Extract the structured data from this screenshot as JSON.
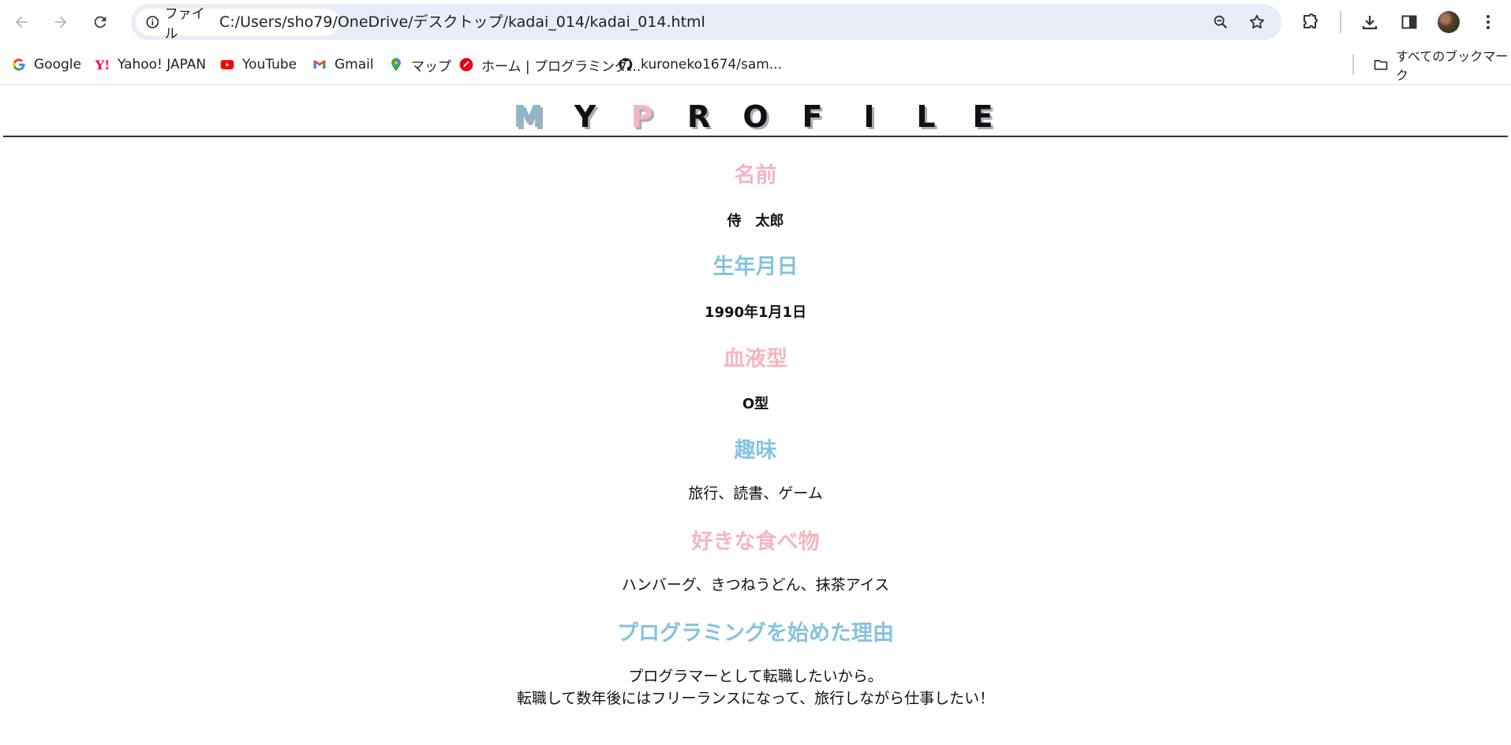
{
  "browser": {
    "chip_label": "ファイル",
    "url": "C:/Users/sho79/OneDrive/デスクトップ/kadai_014/kadai_014.html",
    "icons": [
      "back-icon",
      "forward-icon",
      "reload-icon",
      "info-icon",
      "zoom-icon",
      "star-icon",
      "extensions-icon",
      "download-icon",
      "sidepanel-icon",
      "profile-avatar",
      "menu-icon"
    ]
  },
  "bookmarks": {
    "items": [
      {
        "label": "Google",
        "icon": "google-icon"
      },
      {
        "label": "Yahoo! JAPAN",
        "icon": "yahoo-icon"
      },
      {
        "label": "YouTube",
        "icon": "youtube-icon"
      },
      {
        "label": "Gmail",
        "icon": "gmail-icon"
      },
      {
        "label": "マップ",
        "icon": "maps-icon"
      },
      {
        "label": "ホーム | プログラミング...",
        "icon": "samurai-icon"
      },
      {
        "label": "kuroneko1674/sam...",
        "icon": "github-icon"
      }
    ],
    "all_bookmarks": "すべてのブックマーク"
  },
  "page": {
    "logo_letters": [
      "M",
      "Y",
      "P",
      "R",
      "O",
      "F",
      "I",
      "L",
      "E"
    ],
    "sections": [
      {
        "heading": "名前",
        "value": "侍　太郎"
      },
      {
        "heading": "生年月日",
        "value": "1990年1月1日"
      },
      {
        "heading": "血液型",
        "value": "O型"
      },
      {
        "heading": "趣味",
        "value": "旅行、読書、ゲーム"
      },
      {
        "heading": "好きな食べ物",
        "value": "ハンバーグ、きつねうどん、抹茶アイス"
      },
      {
        "heading": "プログラミングを始めた理由",
        "value_lines": [
          "プログラマーとして転職したいから。",
          "転職して数年後にはフリーランスになって、旅行しながら仕事したい！"
        ]
      }
    ]
  },
  "colors": {
    "pink": "#f4b6c2",
    "blue": "#86c3df",
    "logo_m": "#8fb7c8"
  }
}
